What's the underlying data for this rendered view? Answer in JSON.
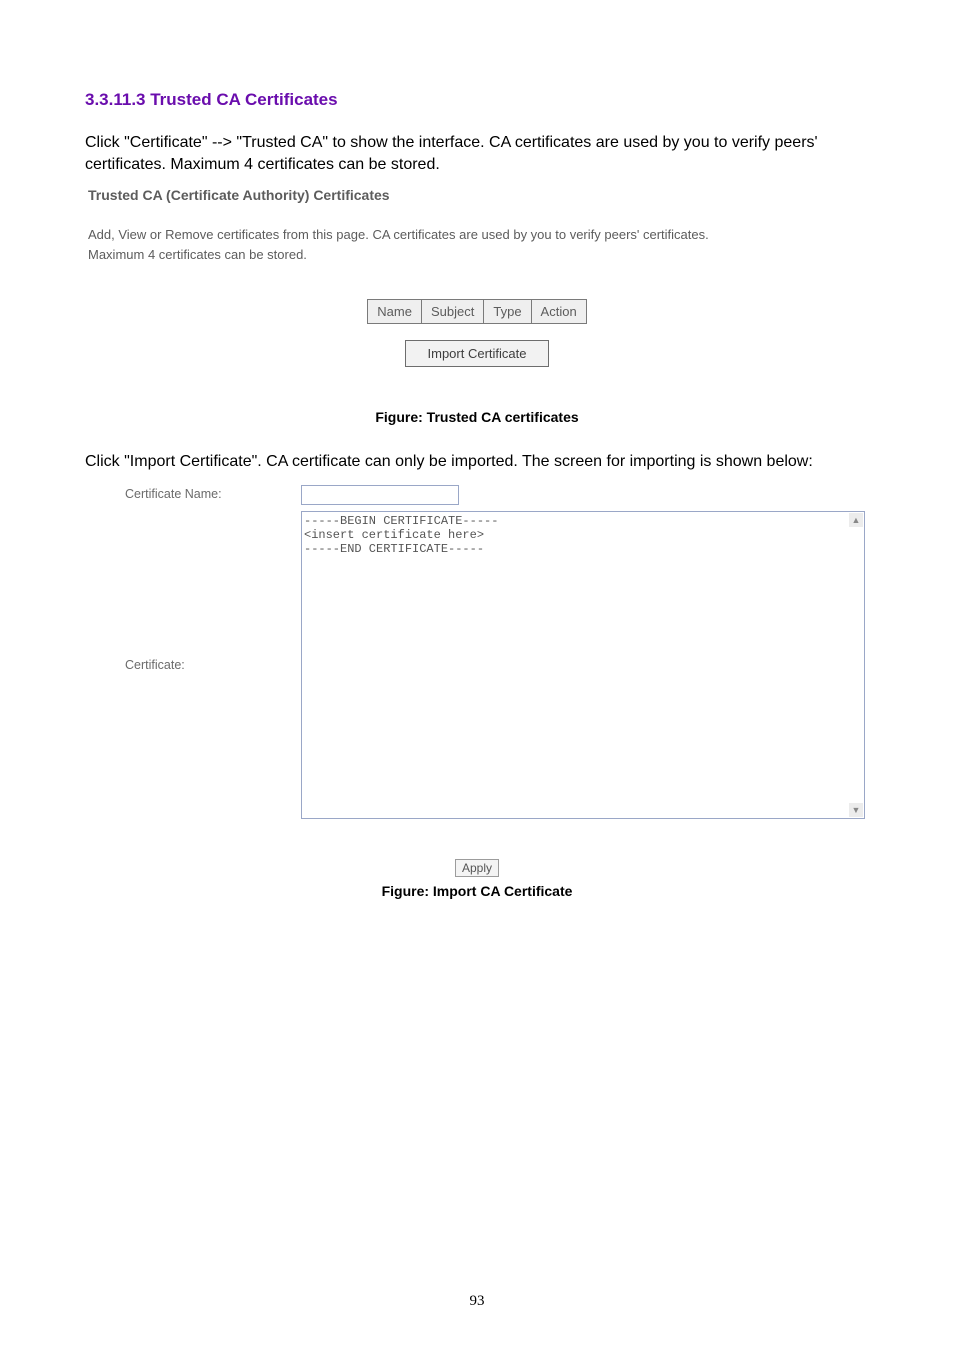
{
  "heading": "3.3.11.3 Trusted CA Certificates",
  "intro": "Click \"Certificate\" --> \"Trusted CA\" to show the interface. CA certificates are used by you to verify peers' certificates. Maximum 4 certificates can be stored.",
  "screenshot1": {
    "subhead": "Trusted CA (Certificate Authority) Certificates",
    "desc_line1": "Add, View or Remove certificates from this page. CA certificates are used by you to verify peers' certificates.",
    "desc_line2": "Maximum 4 certificates can be stored.",
    "table_headers": [
      "Name",
      "Subject",
      "Type",
      "Action"
    ],
    "import_button": "Import Certificate"
  },
  "figure1_caption": "Figure: Trusted CA certificates",
  "mid_text": "Click \"Import Certificate\". CA certificate can only be imported. The screen for importing is shown below:",
  "screenshot2": {
    "name_label": "Certificate Name:",
    "name_value": "",
    "cert_label": "Certificate:",
    "cert_value": "-----BEGIN CERTIFICATE-----\n<insert certificate here>\n-----END CERTIFICATE-----",
    "apply_button": "Apply"
  },
  "figure2_caption": "Figure: Import CA Certificate",
  "page_number": "93"
}
